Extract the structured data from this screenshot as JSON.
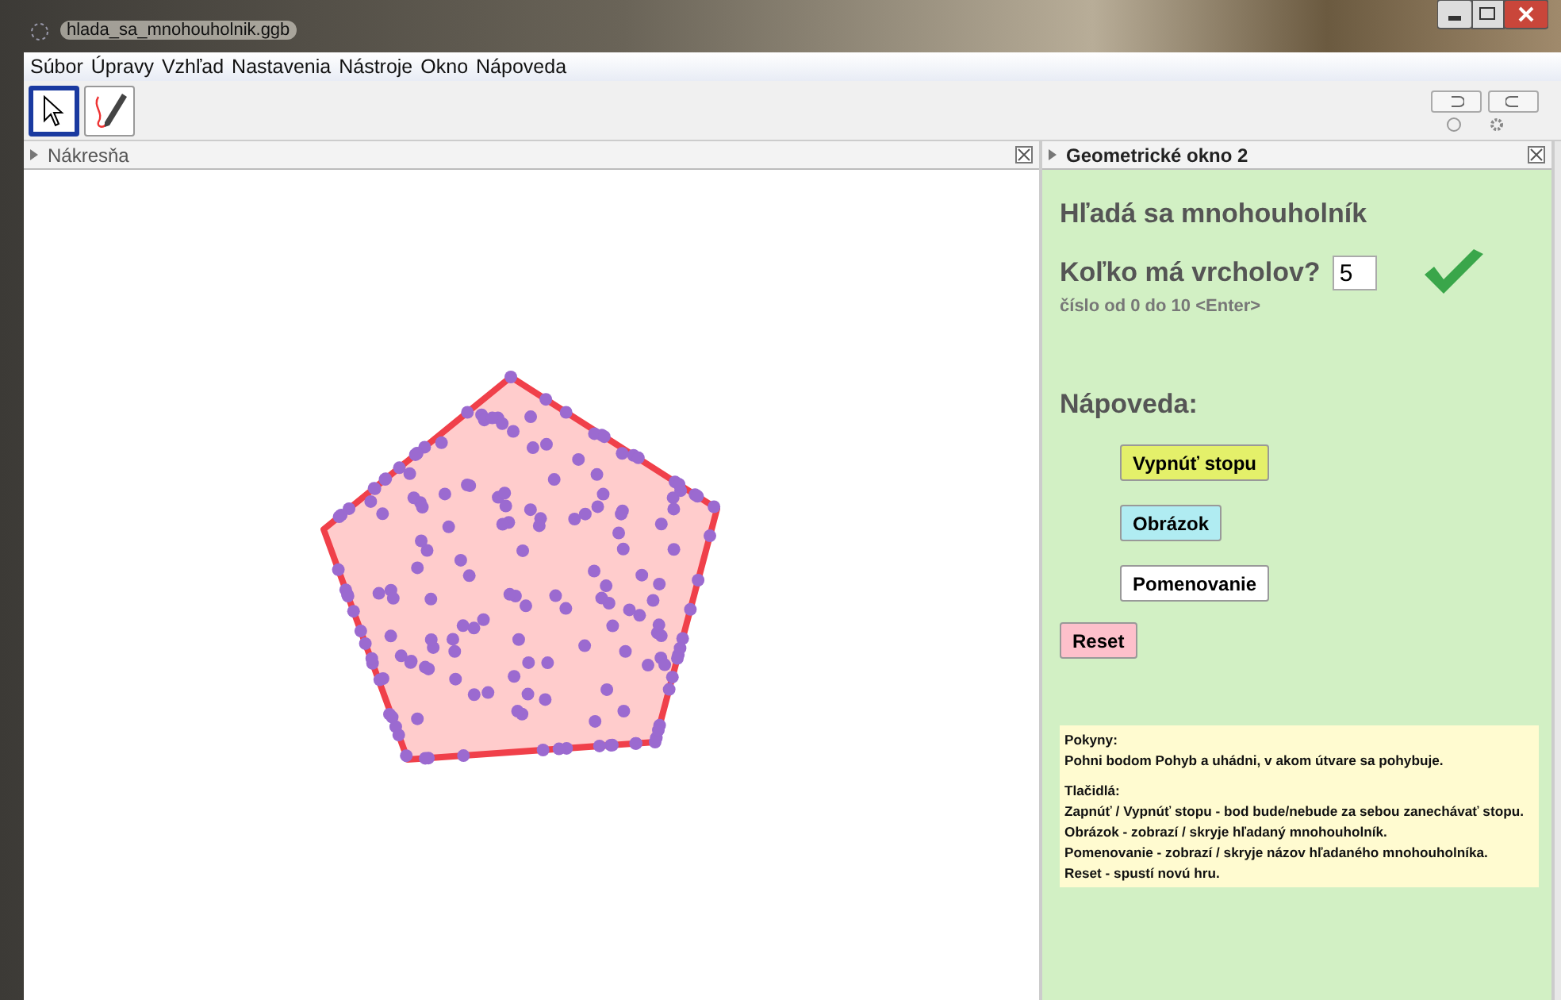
{
  "window": {
    "title": "hlada_sa_mnohouholnik.ggb"
  },
  "menu": [
    "Súbor",
    "Úpravy",
    "Vzhľad",
    "Nastavenia",
    "Nástroje",
    "Okno",
    "Nápoveda"
  ],
  "tools": [
    {
      "kind": "pointer",
      "selected": true
    },
    {
      "kind": "pen",
      "selected": false
    }
  ],
  "graphics_panel": {
    "title": "Nákresňa"
  },
  "side_panel": {
    "title": "Geometrické okno 2",
    "heading": "Hľadá sa mnohouholník",
    "question": "Koľko má vrcholov?",
    "answer": "5",
    "answer_correct": true,
    "hint": "číslo od 0 do 10 <Enter>",
    "help_label": "Nápoveda:",
    "buttons": [
      {
        "label": "Vypnúť stopu",
        "color": "#e4f06a"
      },
      {
        "label": "Obrázok",
        "color": "#b0ecf2"
      },
      {
        "label": "Pomenovanie",
        "color": "#ffffff"
      }
    ],
    "reset_button": "Reset",
    "instructions": [
      [
        "Pokyny:",
        "Pohni bodom Pohyb a uhádni, v akom útvare sa pohybuje."
      ],
      [
        "Tlačidlá:",
        "Zapnúť / Vypnúť stopu - bod bude/nebude za sebou zanechávať stopu.",
        "Obrázok - zobrazí / skryje hľadaný mnohouholník.",
        "Pomenovanie - zobrazí / skryje názov hľadaného mnohouholníka.",
        "Reset - spustí novú hru."
      ]
    ]
  }
}
